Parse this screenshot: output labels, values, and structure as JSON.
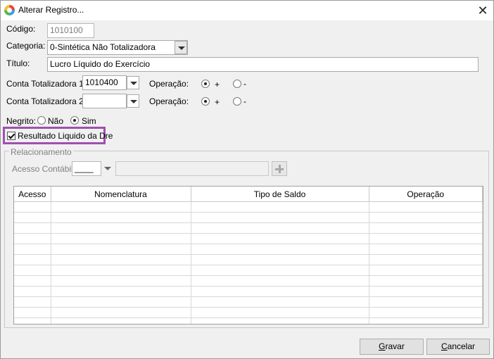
{
  "window": {
    "title": "Alterar Registro..."
  },
  "form": {
    "codigo_label": "Código:",
    "codigo_value": "1010100",
    "categoria_label": "Categoria:",
    "categoria_value": "0-Sintética Não Totalizadora",
    "titulo_label": "Título:",
    "titulo_value": "Lucro Líquido do Exercício",
    "conta1_label": "Conta Totalizadora 1:",
    "conta1_value": "1010400",
    "conta2_label": "Conta Totalizadora 2:",
    "conta2_value": "",
    "operacao_label": "Operação:",
    "op_plus": "+",
    "op_minus": "-",
    "conta1_operacao": "+",
    "conta2_operacao": "+",
    "negrito_label": "Negrito:",
    "negrito_nao": "Não",
    "negrito_sim": "Sim",
    "negrito_selected": "Sim",
    "resultado_label": "Resultado Liquido da Dre",
    "resultado_checked": true
  },
  "relacionamento": {
    "title": "Relacionamento",
    "acesso_label": "Acesso Contábil:",
    "acesso_value": "____",
    "columns": [
      "Acesso",
      "Nomenclatura",
      "Tipo de Saldo",
      "Operação"
    ]
  },
  "buttons": {
    "gravar_first": "G",
    "gravar_rest": "ravar",
    "cancelar_first": "C",
    "cancelar_rest": "ancelar"
  },
  "colors": {
    "highlight": "#a04fb0"
  }
}
